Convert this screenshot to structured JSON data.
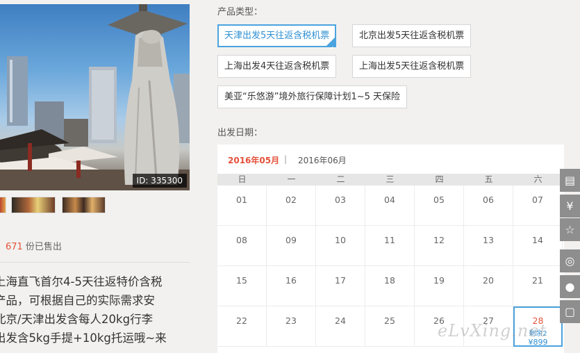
{
  "hero": {
    "id_badge": "ID: 335300"
  },
  "sales": {
    "count": "671",
    "suffix": "份已售出"
  },
  "description": {
    "lines": [
      "上海直飞首尔4-5天往返特价含税",
      "产品，可根据自己的实际需求安",
      "北京/天津出发含每人20kg行李",
      "出发含5kg手提+10kg托运哦~来"
    ]
  },
  "product_type": {
    "label": "产品类型：",
    "options": [
      {
        "label": "天津出发5天往返含税机票",
        "selected": true
      },
      {
        "label": "北京出发5天往返含税机票",
        "selected": false
      },
      {
        "label": "上海出发4天往返含税机票",
        "selected": false
      },
      {
        "label": "上海出发5天往返含税机票",
        "selected": false
      },
      {
        "label": "美亚“乐悠游”境外旅行保障计划1~5 天保险",
        "selected": false
      }
    ]
  },
  "departure": {
    "label": "出发日期：",
    "months": [
      "2016年05月",
      "2016年06月"
    ],
    "separator": "|",
    "weekdays": [
      "日",
      "一",
      "二",
      "三",
      "四",
      "五",
      "六"
    ],
    "rows": [
      [
        "01",
        "02",
        "03",
        "04",
        "05",
        "06",
        "07"
      ],
      [
        "08",
        "09",
        "10",
        "11",
        "12",
        "13",
        "14"
      ],
      [
        "15",
        "16",
        "17",
        "18",
        "19",
        "20",
        "21"
      ],
      [
        "22",
        "23",
        "24",
        "25",
        "26",
        "27",
        "28"
      ]
    ],
    "highlight": {
      "day": "28",
      "remaining": "剩余2",
      "price": "¥899"
    }
  },
  "watermark": "eLvXing.net",
  "side_toolbar": [
    "clipboard-icon",
    "yen-icon",
    "star-icon",
    "weibo-icon",
    "wechat-icon",
    "feedback-icon"
  ],
  "colors": {
    "accent_blue": "#4aa3df",
    "accent_red": "#e4513a",
    "toolbar_gray": "#8e8e8e"
  }
}
